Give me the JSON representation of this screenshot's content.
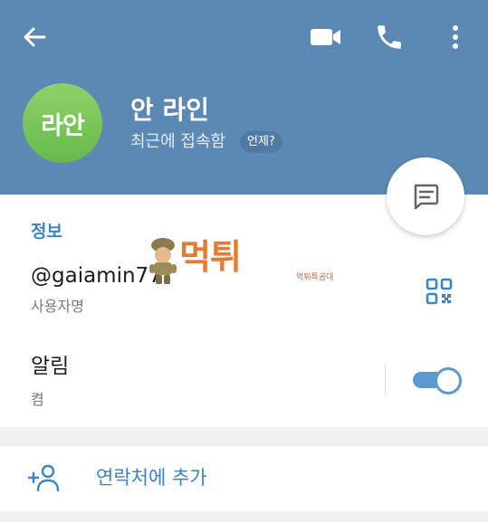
{
  "header": {
    "back_icon": "arrow-left-icon",
    "video_icon": "video-camera-icon",
    "phone_icon": "phone-icon",
    "more_icon": "more-vertical-icon",
    "background_color": "#5b89b4"
  },
  "profile": {
    "avatar_text": "라안",
    "name": "안 라인",
    "status": "최근에 접속함",
    "when_badge": "언제?",
    "avatar_color": "#7ac85a"
  },
  "message_button": {
    "icon": "message-icon"
  },
  "info": {
    "section_title": "정보",
    "username": "@gaiamin77",
    "username_label": "사용자명",
    "qr_icon": "qr-code-icon",
    "notifications_label": "알림",
    "notifications_value": "켬",
    "notifications_on": true
  },
  "watermark": {
    "text": "먹튀",
    "small_text": "먹튀특공대"
  },
  "actions": {
    "add_contact_icon": "add-person-icon",
    "add_contact_label": "연락처에 추가"
  },
  "colors": {
    "accent": "#3a84c5",
    "toggle": "#5b9bd1"
  }
}
